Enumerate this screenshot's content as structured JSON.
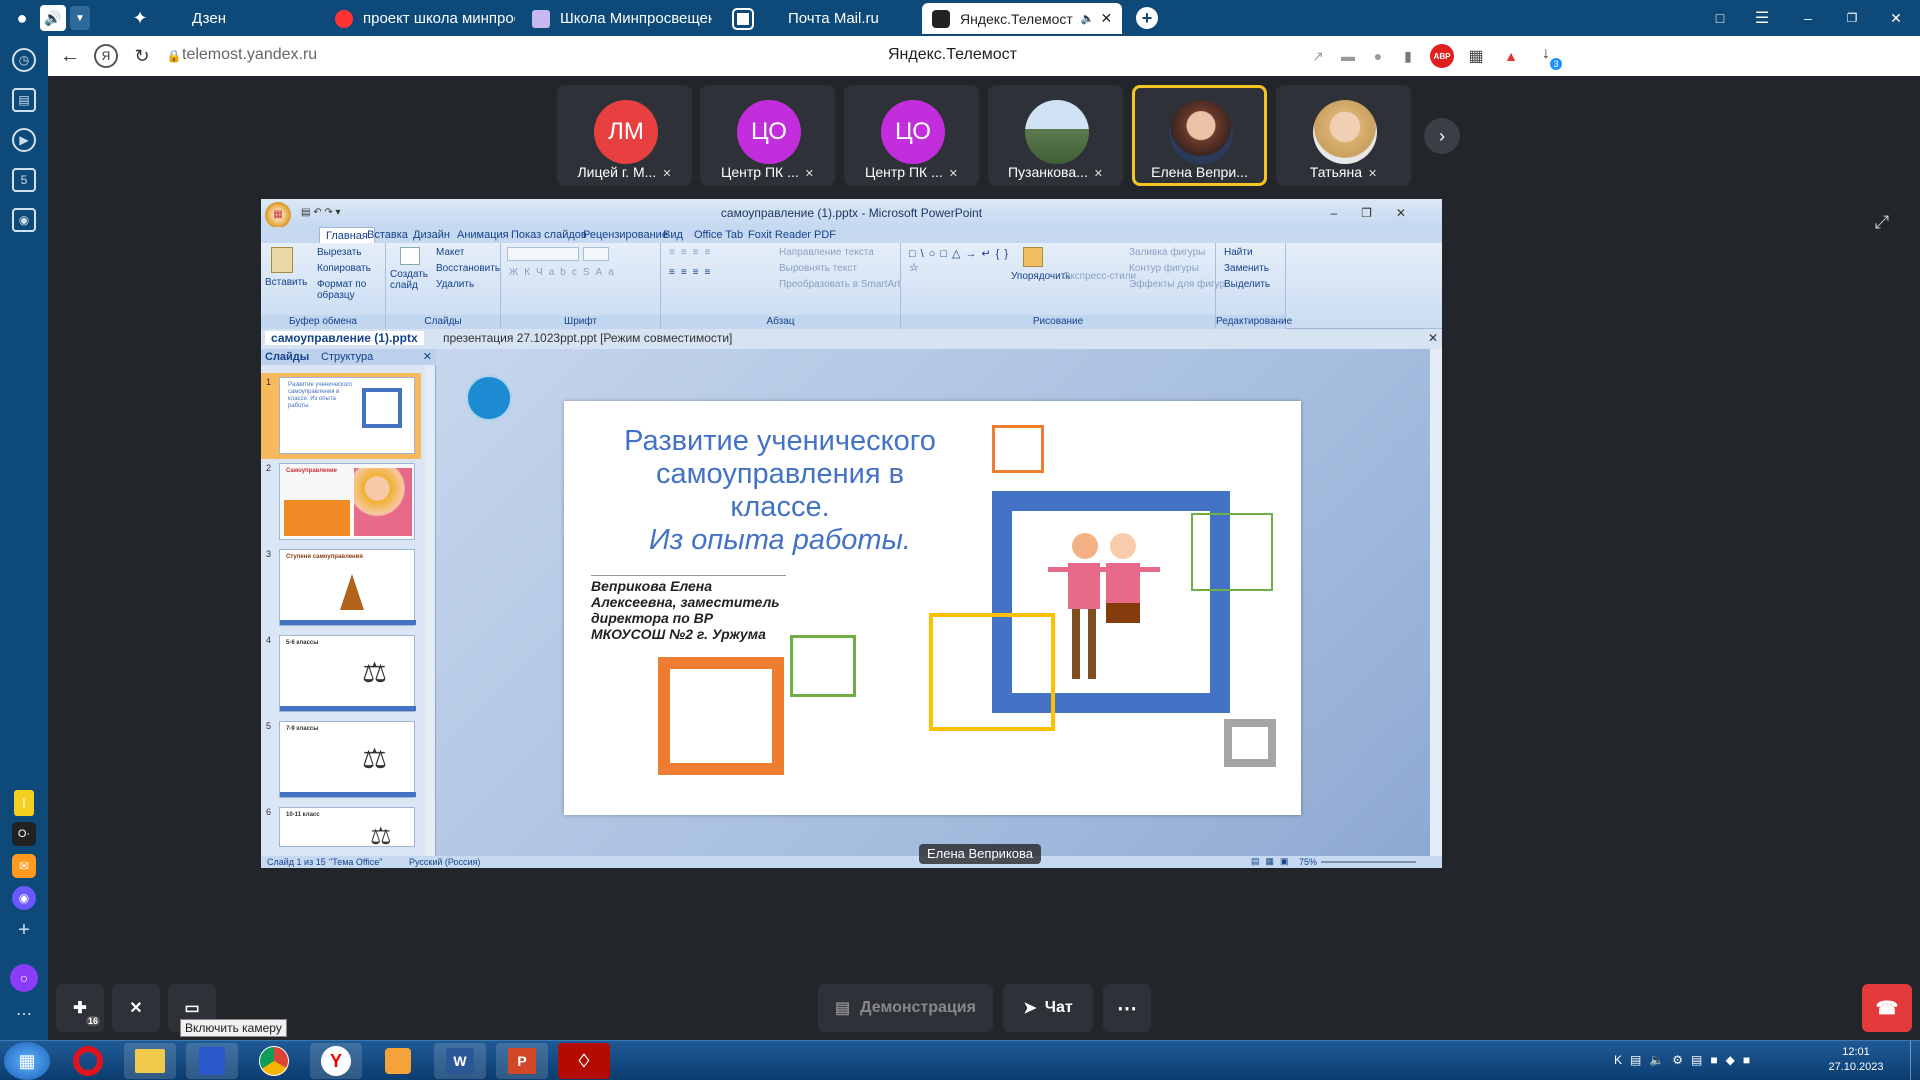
{
  "browser": {
    "tabs": [
      {
        "label": "Дзен"
      },
      {
        "label": "проект школа минпросве"
      },
      {
        "label": "Школа Минпросвещения"
      },
      {
        "label": "Почта Mail.ru"
      },
      {
        "label": "Яндекс.Телемост"
      }
    ],
    "url": "telemost.yandex.ru",
    "page_title": "Яндекс.Телемост",
    "extension_badge": "ABP",
    "downloads_badge": "3"
  },
  "participants": [
    {
      "initials": "ЛМ",
      "name": "Лицей г. М...",
      "color": "#e84040"
    },
    {
      "initials": "ЦО",
      "name": "Центр ПК ...",
      "color": "#c22edc"
    },
    {
      "initials": "ЦО",
      "name": "Центр ПК ...",
      "color": "#c22edc"
    },
    {
      "initials": "",
      "name": "Пузанкова...",
      "color": "#6e8a5c"
    },
    {
      "initials": "",
      "name": "Елена Вепри...",
      "color": "#7a5a46"
    },
    {
      "initials": "",
      "name": "Татьяна",
      "color": "#c9a88a"
    }
  ],
  "powerpoint": {
    "window_title": "самоуправление (1).pptx - Microsoft PowerPoint",
    "ribbon_tabs": [
      "Главная",
      "Вставка",
      "Дизайн",
      "Анимация",
      "Показ слайдов",
      "Рецензирование",
      "Вид",
      "Office Tab",
      "Foxit Reader PDF"
    ],
    "groups": {
      "clipboard": {
        "label": "Буфер обмена",
        "paste": "Вставить",
        "cut": "Вырезать",
        "copy": "Копировать",
        "format": "Формат по образцу"
      },
      "slides": {
        "label": "Слайды",
        "create": "Создать слайд",
        "layout": "Макет",
        "restore": "Восстановить",
        "delete": "Удалить"
      },
      "font": {
        "label": "Шрифт"
      },
      "paragraph": {
        "label": "Абзац",
        "direction": "Направление текста",
        "align": "Выровнять текст",
        "smartart": "Преобразовать в SmartArt"
      },
      "drawing": {
        "label": "Рисование",
        "arrange": "Упорядочить",
        "styles": "Экспресс-стили",
        "fill": "Заливка фигуры",
        "outline": "Контур фигуры",
        "effects": "Эффекты для фигур"
      },
      "editing": {
        "label": "Редактирование",
        "find": "Найти",
        "replace": "Заменить",
        "select": "Выделить"
      }
    },
    "doc_tabs": [
      "самоуправление (1).pptx",
      "презентация 27.1023ppt.ppt [Режим совместимости]"
    ],
    "pane_tabs": [
      "Слайды",
      "Структура"
    ],
    "thumbnails": [
      {
        "num": "1",
        "title": "Развитие ученического самоуправления в классе. Из опыта работы."
      },
      {
        "num": "2",
        "title": "Самоуправление"
      },
      {
        "num": "3",
        "title": "Ступени самоуправления"
      },
      {
        "num": "4",
        "title": "5-6 классы"
      },
      {
        "num": "5",
        "title": "7-9 классы"
      },
      {
        "num": "6",
        "title": "10-11 класс"
      }
    ],
    "slide": {
      "title_line1": "Развитие ученического",
      "title_line2": "самоуправления в",
      "title_line3": "классе.",
      "subtitle": "Из опыта работы.",
      "author_line1": "Веприкова Елена",
      "author_line2": "Алексеевна, заместитель",
      "author_line3": "директора по ВР",
      "author_line4": "МКОУСОШ №2 г. Уржума"
    },
    "status": {
      "slide": "Слайд 1 из 15",
      "theme": "\"Тема Office\"",
      "lang": "Русский (Россия)",
      "zoom": "75%"
    }
  },
  "speaker_label": "Елена Веприкова",
  "controls": {
    "camera_tooltip": "Включить камеру",
    "demo": "Демонстрация",
    "chat": "Чат",
    "participants_count": "16"
  },
  "taskbar": {
    "time": "12:01",
    "date": "27.10.2023"
  }
}
